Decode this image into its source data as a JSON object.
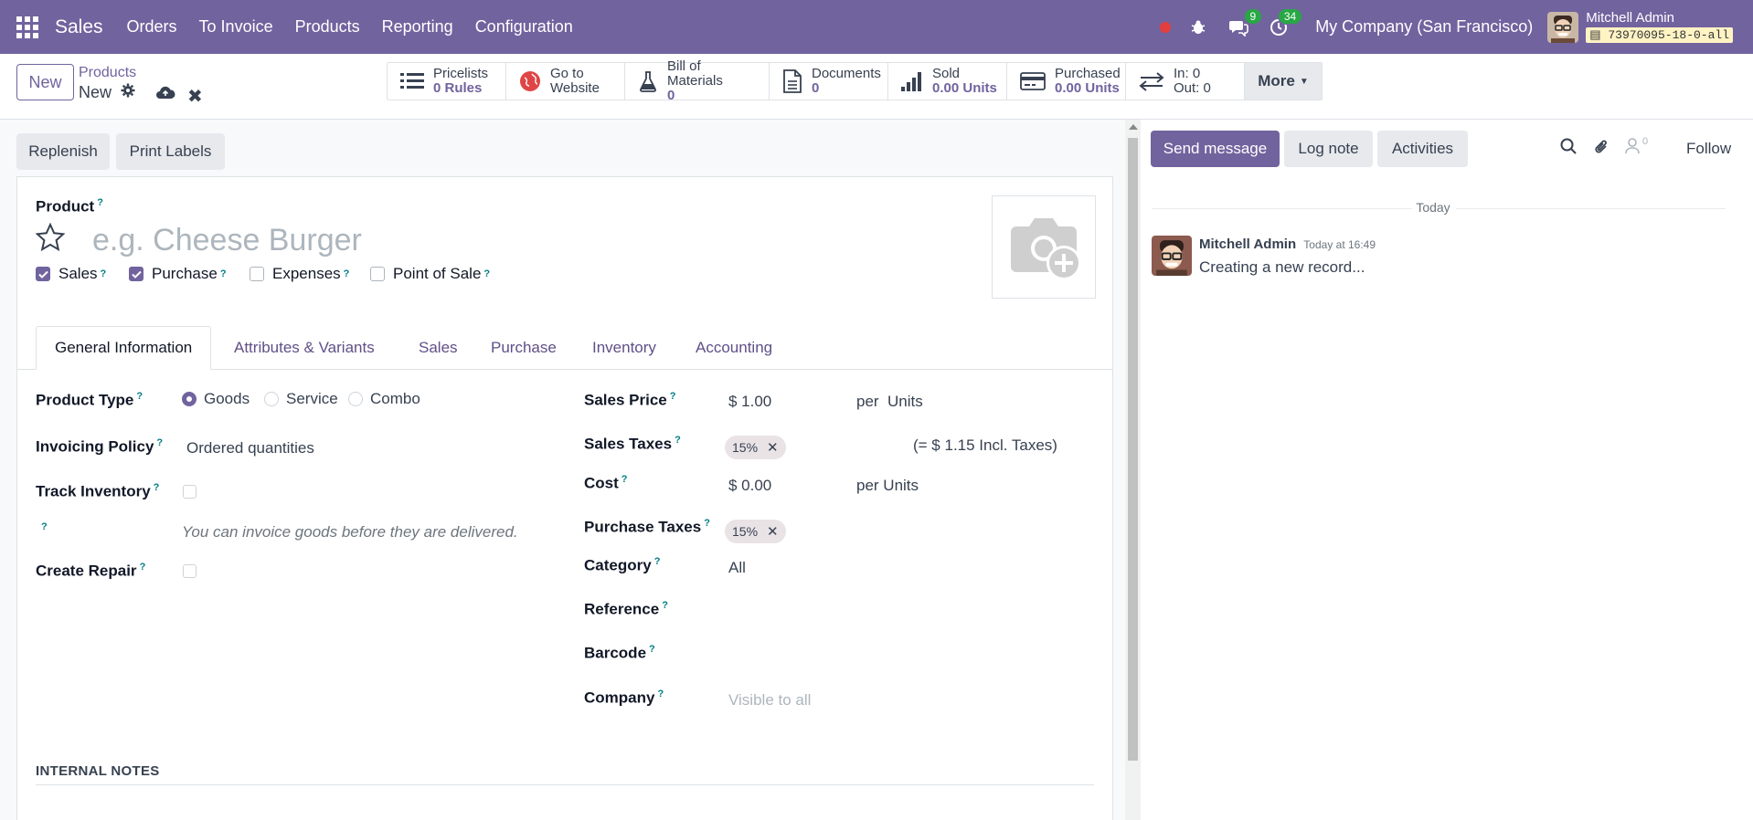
{
  "navbar": {
    "app_name": "Sales",
    "menu": [
      "Orders",
      "To Invoice",
      "Products",
      "Reporting",
      "Configuration"
    ],
    "messages_count": "9",
    "activities_count": "34",
    "company": "My Company (San Francisco)",
    "user_name": "Mitchell Admin",
    "database": "73970095-18-0-all",
    "color": "#71639e"
  },
  "control": {
    "new_label": "New",
    "breadcrumb_parent": "Products",
    "breadcrumb_current": "New"
  },
  "smart_buttons": [
    {
      "label": "Pricelists",
      "value": "0 Rules",
      "icon": "list-icon"
    },
    {
      "label": "Go to",
      "value": "Website",
      "icon": "globe-icon"
    },
    {
      "label": "Bill of Materials",
      "value": "0",
      "icon": "flask-icon"
    },
    {
      "label": "Documents",
      "value": "0",
      "icon": "document-icon"
    },
    {
      "label": "Sold",
      "value": "0.00 Units",
      "icon": "signal-icon"
    },
    {
      "label": "Purchased",
      "value": "0.00 Units",
      "icon": "credit-card-icon"
    },
    {
      "label": "In: 0",
      "value": "Out: 0",
      "icon": "exchange-icon"
    }
  ],
  "more_label": "More",
  "statusbar": {
    "replenish": "Replenish",
    "print_labels": "Print Labels"
  },
  "form": {
    "product_label": "Product",
    "name_placeholder": "e.g. Cheese Burger",
    "checks": [
      {
        "label": "Sales",
        "checked": true
      },
      {
        "label": "Purchase",
        "checked": true
      },
      {
        "label": "Expenses",
        "checked": false
      },
      {
        "label": "Point of Sale",
        "checked": false
      }
    ],
    "tabs": [
      "General Information",
      "Attributes & Variants",
      "Sales",
      "Purchase",
      "Inventory",
      "Accounting"
    ],
    "product_type_label": "Product Type",
    "product_type_options": [
      "Goods",
      "Service",
      "Combo"
    ],
    "product_type_selected": "Goods",
    "invoicing_policy_label": "Invoicing Policy",
    "invoicing_policy_value": "Ordered quantities",
    "track_inventory_label": "Track Inventory",
    "invoice_hint": "You can invoice goods before they are delivered.",
    "create_repair_label": "Create Repair",
    "sales_price_label": "Sales Price",
    "sales_price_value": "$ 1.00",
    "sales_price_per": "per",
    "sales_price_uom": "Units",
    "sales_taxes_label": "Sales Taxes",
    "sales_tax_tag": "15%",
    "incl_taxes": "(= $ 1.15 Incl. Taxes)",
    "cost_label": "Cost",
    "cost_value": "$ 0.00",
    "cost_per": "per Units",
    "purchase_taxes_label": "Purchase Taxes",
    "purchase_tax_tag": "15%",
    "category_label": "Category",
    "category_value": "All",
    "reference_label": "Reference",
    "barcode_label": "Barcode",
    "company_label": "Company",
    "company_placeholder": "Visible to all",
    "internal_notes": "INTERNAL NOTES",
    "help_mark": "?"
  },
  "chatter": {
    "send_message": "Send message",
    "log_note": "Log note",
    "activities": "Activities",
    "followers_count": "0",
    "follow": "Follow",
    "date_separator": "Today",
    "author": "Mitchell Admin",
    "time": "Today at 16:49",
    "body": "Creating a new record..."
  }
}
